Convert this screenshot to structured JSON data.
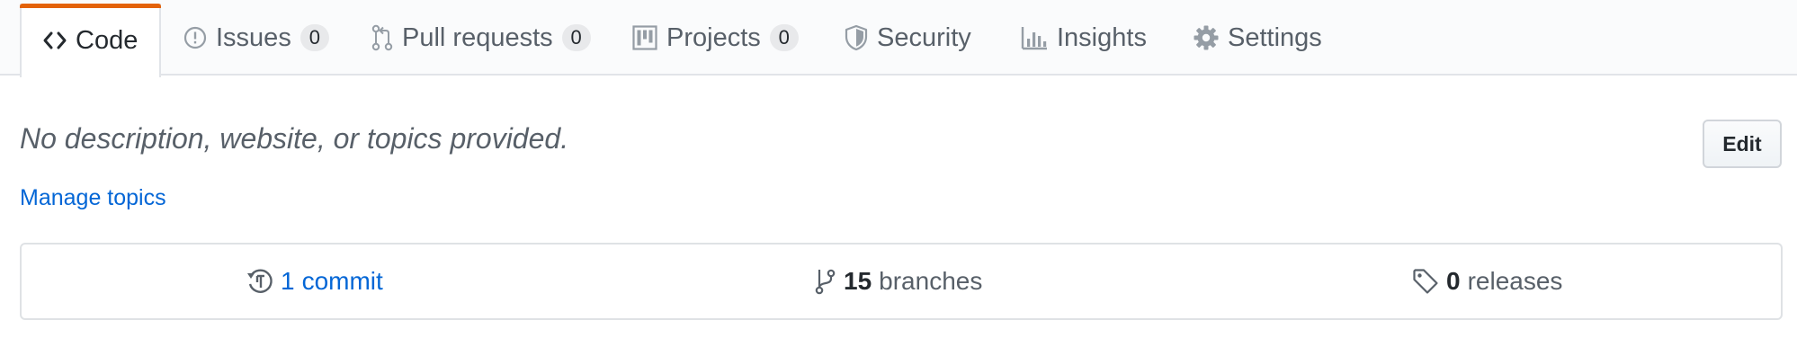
{
  "tabs": {
    "code": {
      "label": "Code",
      "icon": "code-icon"
    },
    "issues": {
      "label": "Issues",
      "count": "0",
      "icon": "issue-opened-icon"
    },
    "pull_requests": {
      "label": "Pull requests",
      "count": "0",
      "icon": "git-pull-request-icon"
    },
    "projects": {
      "label": "Projects",
      "count": "0",
      "icon": "project-icon"
    },
    "security": {
      "label": "Security",
      "icon": "shield-icon"
    },
    "insights": {
      "label": "Insights",
      "icon": "graph-icon"
    },
    "settings": {
      "label": "Settings",
      "icon": "gear-icon"
    }
  },
  "repo": {
    "description": "No description, website, or topics provided.",
    "manage_topics": "Manage topics",
    "edit_label": "Edit"
  },
  "summary": {
    "commits": {
      "count": "1",
      "label": "commit",
      "icon": "history-icon"
    },
    "branches": {
      "count": "15",
      "label": "branches",
      "icon": "git-branch-icon"
    },
    "releases": {
      "count": "0",
      "label": "releases",
      "icon": "tag-icon"
    }
  },
  "colors": {
    "selected_tab_accent": "#e36209",
    "link": "#0366d6",
    "muted_text": "#586069",
    "primary_text": "#24292e"
  }
}
